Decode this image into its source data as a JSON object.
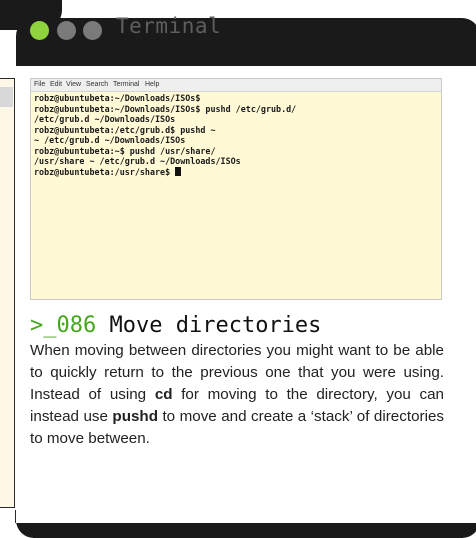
{
  "window": {
    "title": "Terminal"
  },
  "terminal": {
    "menu": [
      "File",
      "Edit",
      "View",
      "Search",
      "Terminal",
      "Help"
    ],
    "lines": [
      "robz@ubuntubeta:~/Downloads/ISOs$",
      "robz@ubuntubeta:~/Downloads/ISOs$ pushd /etc/grub.d/",
      "/etc/grub.d ~/Downloads/ISOs",
      "robz@ubuntubeta:/etc/grub.d$ pushd ~",
      "~ /etc/grub.d ~/Downloads/ISOs",
      "robz@ubuntubeta:~$ pushd /usr/share/",
      "/usr/share ~ /etc/grub.d ~/Downloads/ISOs",
      "robz@ubuntubeta:/usr/share$ "
    ]
  },
  "article": {
    "prefix": ">_",
    "number": "086",
    "heading": "Move directories",
    "para_1": "When moving between directories you might want to be able to quickly return to the previous one that you were using. Instead of using ",
    "code_1": "cd",
    "para_2": " for moving to the directory, you can instead use ",
    "code_2": "pushd",
    "para_3": " to move and create a ‘stack’ of directories to move between."
  },
  "colors": {
    "accent": "#46a61c",
    "dot_green": "#8fd43c",
    "dot_grey": "#7a7a7a",
    "card_bg": "#1a1a1a",
    "terminal_bg": "#fff9d6"
  }
}
